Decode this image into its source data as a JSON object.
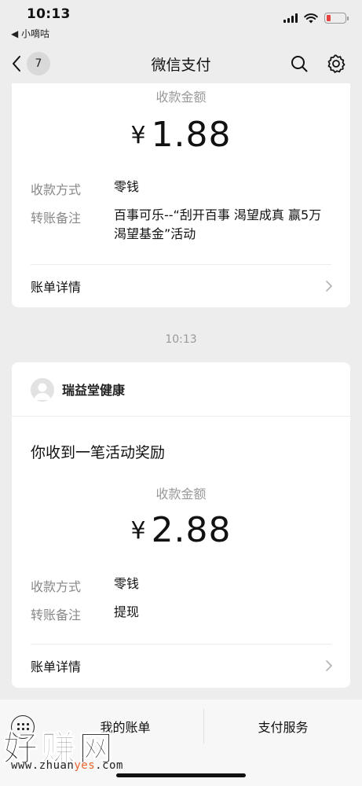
{
  "status_bar": {
    "time": "10:13",
    "back_app": "◀ 小嘀咕",
    "battery_color": "#e64340"
  },
  "nav": {
    "title": "微信支付",
    "unread_count": "7",
    "search_icon": "search-icon",
    "settings_icon": "gear-icon"
  },
  "messages": [
    {
      "amount_label": "收款金额",
      "currency": "¥",
      "amount": "1.88",
      "method_label": "收款方式",
      "method_value": "零钱",
      "note_label": "转账备注",
      "note_value": "百事可乐--“刮开百事 渴望成真 赢5万渴望基金”活动",
      "detail_label": "账单详情"
    },
    {
      "merchant_name": "瑞益堂健康",
      "heading": "你收到一笔活动奖励",
      "amount_label": "收款金额",
      "currency": "¥",
      "amount": "2.88",
      "method_label": "收款方式",
      "method_value": "零钱",
      "note_label": "转账备注",
      "note_value": "提现",
      "detail_label": "账单详情"
    }
  ],
  "timestamp": "10:13",
  "bottom_bar": {
    "bills_label": "我的账单",
    "services_label": "支付服务"
  },
  "watermark": {
    "big": "好赚网",
    "url_prefix": "www.zhuan",
    "url_accent": "yes",
    "url_suffix": ".com",
    "accent_color": "#e8622a"
  }
}
